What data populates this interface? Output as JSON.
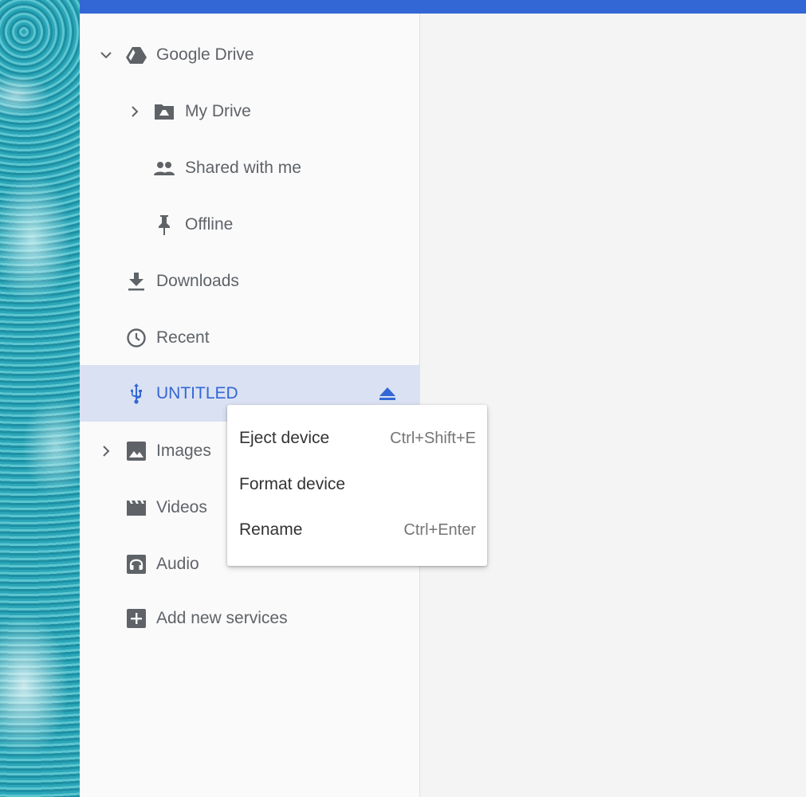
{
  "sidebar": {
    "items": [
      {
        "label": "Google Drive",
        "icon": "google-drive-icon",
        "expanded": true
      },
      {
        "label": "My Drive",
        "icon": "my-drive-folder-icon",
        "expanded": false
      },
      {
        "label": "Shared with me",
        "icon": "people-icon"
      },
      {
        "label": "Offline",
        "icon": "pin-icon"
      },
      {
        "label": "Downloads",
        "icon": "download-icon"
      },
      {
        "label": "Recent",
        "icon": "clock-icon"
      },
      {
        "label": "UNTITLED",
        "icon": "usb-icon",
        "selected": true
      },
      {
        "label": "Images",
        "icon": "image-icon",
        "expanded": false
      },
      {
        "label": "Videos",
        "icon": "video-icon"
      },
      {
        "label": "Audio",
        "icon": "headphones-icon"
      },
      {
        "label": "Add new services",
        "icon": "add-box-icon"
      }
    ]
  },
  "context_menu": {
    "items": [
      {
        "label": "Eject device",
        "shortcut": "Ctrl+Shift+E"
      },
      {
        "label": "Format device",
        "shortcut": ""
      },
      {
        "label": "Rename",
        "shortcut": "Ctrl+Enter"
      }
    ]
  },
  "colors": {
    "accent": "#3367d6",
    "selected_bg": "#dae1f2",
    "icon_gray": "#5f6368"
  }
}
